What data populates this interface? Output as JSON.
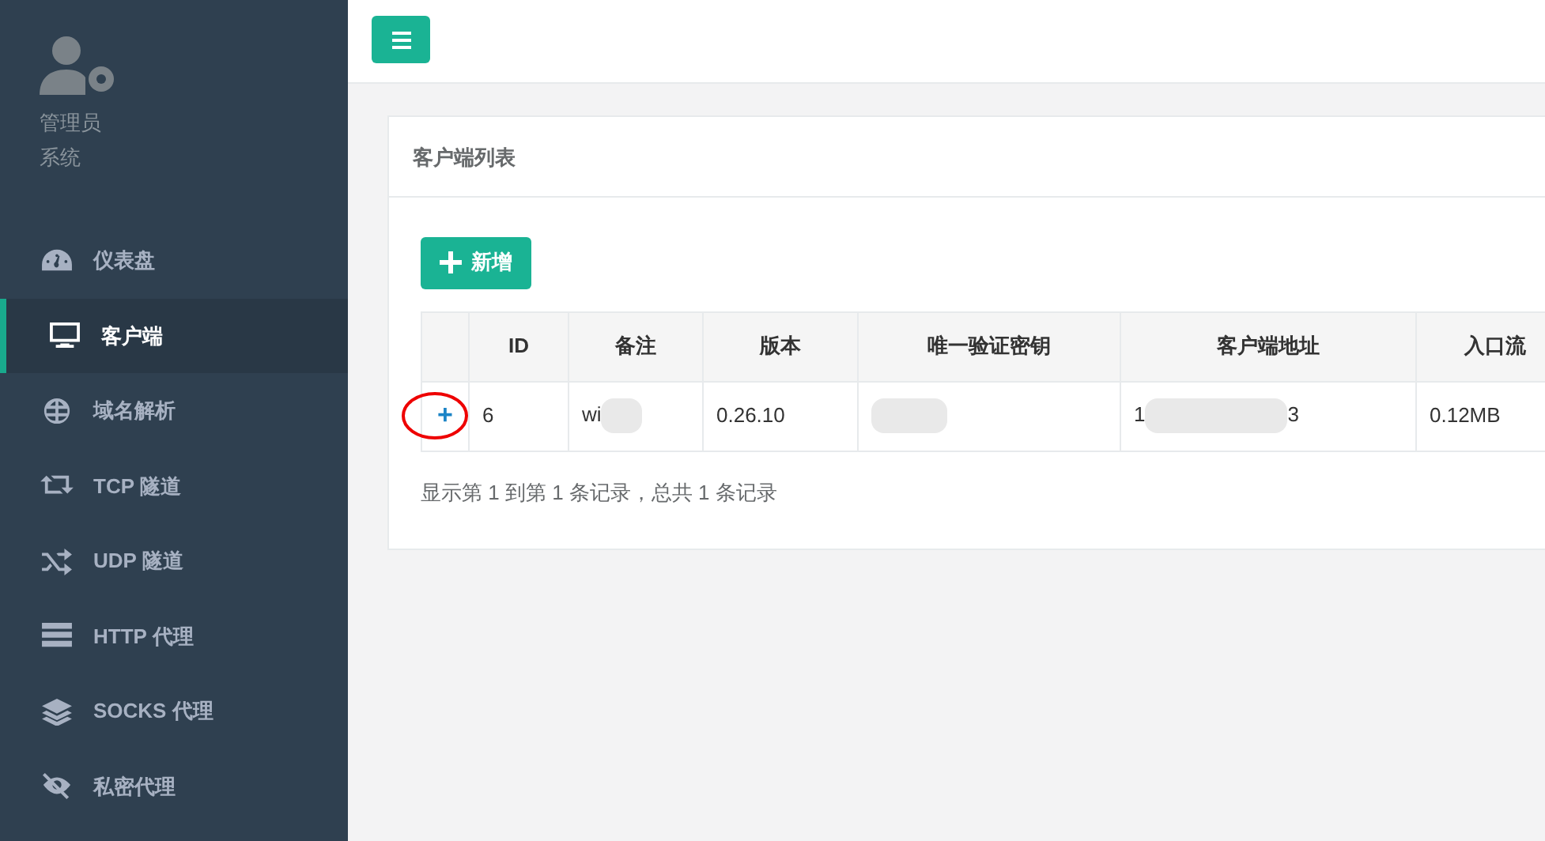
{
  "profile": {
    "name": "管理员",
    "role": "系统"
  },
  "sidebar": {
    "items": [
      {
        "label": "仪表盘",
        "selected": false
      },
      {
        "label": "客户端",
        "selected": true
      },
      {
        "label": "域名解析",
        "selected": false
      },
      {
        "label": "TCP 隧道",
        "selected": false
      },
      {
        "label": "UDP 隧道",
        "selected": false
      },
      {
        "label": "HTTP 代理",
        "selected": false
      },
      {
        "label": "SOCKS 代理",
        "selected": false
      },
      {
        "label": "私密代理",
        "selected": false
      }
    ]
  },
  "panel": {
    "title": "客户端列表",
    "add_button": "新增",
    "table": {
      "columns": [
        "",
        "ID",
        "备注",
        "版本",
        "唯一验证密钥",
        "客户端地址",
        "入口流"
      ],
      "rows": [
        {
          "expand": "+",
          "id": "6",
          "note": "wi",
          "version": "0.26.10",
          "address_start": "1",
          "address_end": "3",
          "traffic_in": "0.12MB"
        }
      ]
    },
    "footer": "显示第 1 到第 1 条记录，总共 1 条记录"
  }
}
